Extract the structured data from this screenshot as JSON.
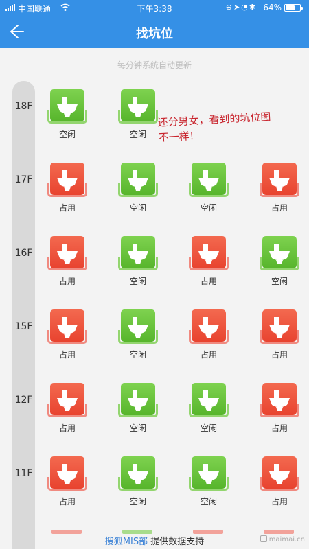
{
  "status_bar": {
    "carrier": "中国联通",
    "time": "下午3:38",
    "battery_percent": "64%",
    "battery_level": 0.64
  },
  "header": {
    "title": "找坑位",
    "back_icon": "arrow-left-icon"
  },
  "subtitle": "每分钟系统自动更新",
  "floors": [
    {
      "label": "18F",
      "stalls": [
        {
          "status": "free",
          "label": "空闲"
        },
        {
          "status": "free",
          "label": "空闲"
        }
      ]
    },
    {
      "label": "17F",
      "stalls": [
        {
          "status": "occupied",
          "label": "占用"
        },
        {
          "status": "free",
          "label": "空闲"
        },
        {
          "status": "free",
          "label": "空闲"
        },
        {
          "status": "occupied",
          "label": "占用"
        }
      ]
    },
    {
      "label": "16F",
      "stalls": [
        {
          "status": "occupied",
          "label": "占用"
        },
        {
          "status": "free",
          "label": "空闲"
        },
        {
          "status": "occupied",
          "label": "占用"
        },
        {
          "status": "free",
          "label": "空闲"
        }
      ]
    },
    {
      "label": "15F",
      "stalls": [
        {
          "status": "occupied",
          "label": "占用"
        },
        {
          "status": "free",
          "label": "空闲"
        },
        {
          "status": "occupied",
          "label": "占用"
        },
        {
          "status": "occupied",
          "label": "占用"
        }
      ]
    },
    {
      "label": "12F",
      "stalls": [
        {
          "status": "occupied",
          "label": "占用"
        },
        {
          "status": "free",
          "label": "空闲"
        },
        {
          "status": "free",
          "label": "空闲"
        },
        {
          "status": "occupied",
          "label": "占用"
        }
      ]
    },
    {
      "label": "11F",
      "stalls": [
        {
          "status": "occupied",
          "label": "占用"
        },
        {
          "status": "free",
          "label": "空闲"
        },
        {
          "status": "free",
          "label": "空闲"
        },
        {
          "status": "occupied",
          "label": "占用"
        }
      ]
    }
  ],
  "annotation": {
    "line1": "还分男女，看到的坑位图",
    "line2": "不一样！"
  },
  "footer": {
    "brand": "搜狐MIS部",
    "text": " 提供数据支持"
  },
  "watermark": "maimai.cn",
  "colors": {
    "header_blue": "#3590e6",
    "free_green": "#6cc63e",
    "occupied_red": "#ec4a36",
    "annotation_red": "#c8232c",
    "brand_blue": "#3b82d6"
  }
}
